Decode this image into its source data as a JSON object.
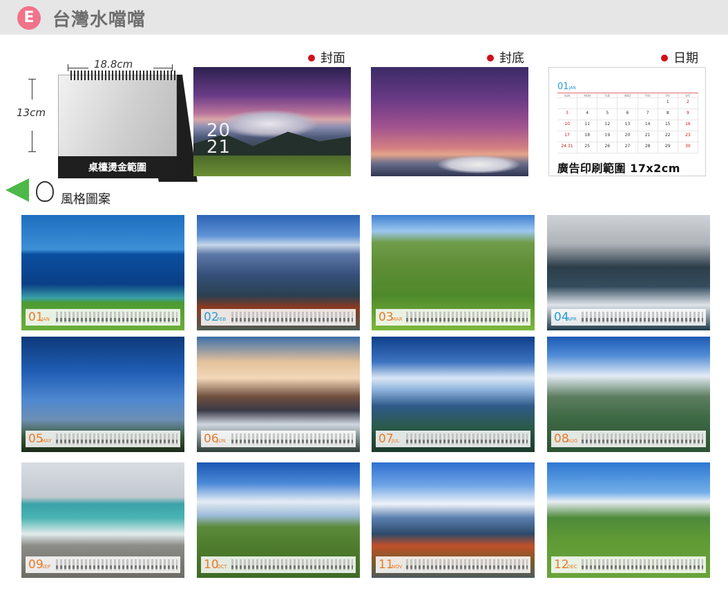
{
  "header": {
    "badge": "E",
    "title": "台灣水噹噹"
  },
  "desk": {
    "width_label": "18.8cm",
    "height_label": "13cm",
    "foil_label": "桌檯燙金範圍"
  },
  "labels": {
    "cover": "封面",
    "back": "封底",
    "dates": "日期"
  },
  "cover": {
    "year_top": "20",
    "year_bottom": "21"
  },
  "date_card": {
    "month_num": "01",
    "month_name": "JAN",
    "weekdays": [
      "SUN",
      "MON",
      "TUE",
      "WED",
      "THU",
      "FRI",
      "SAT"
    ],
    "cells": [
      "",
      "",
      "",
      "",
      "",
      "1",
      "2",
      "3",
      "4",
      "5",
      "6",
      "7",
      "8",
      "9",
      "10",
      "11",
      "12",
      "13",
      "14",
      "15",
      "16",
      "17",
      "18",
      "19",
      "20",
      "21",
      "22",
      "23",
      "24 31",
      "25",
      "26",
      "27",
      "28",
      "29",
      "30"
    ],
    "ad_area": "廣告印刷範圍 17x2cm"
  },
  "style_label": "風格圖案",
  "months": [
    {
      "num": "01",
      "name": "JAN"
    },
    {
      "num": "02",
      "name": "FEB"
    },
    {
      "num": "03",
      "name": "MAR"
    },
    {
      "num": "04",
      "name": "APR"
    },
    {
      "num": "05",
      "name": "MAY"
    },
    {
      "num": "06",
      "name": "JUN"
    },
    {
      "num": "07",
      "name": "JUL"
    },
    {
      "num": "08",
      "name": "AUG"
    },
    {
      "num": "09",
      "name": "SEP"
    },
    {
      "num": "10",
      "name": "OCT"
    },
    {
      "num": "11",
      "name": "NOV"
    },
    {
      "num": "12",
      "name": "DEC"
    }
  ],
  "colors": {
    "accent_red": "#d0101c",
    "badge_pink": "#f0738a",
    "arrow_green": "#4db848",
    "month_orange": "#e97a2a",
    "month_blue": "#2a9bd0"
  }
}
